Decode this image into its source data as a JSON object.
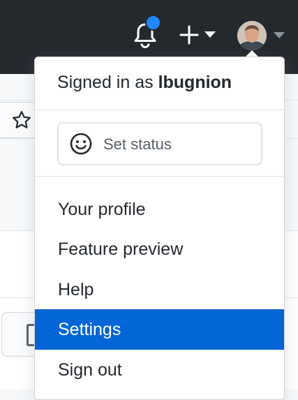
{
  "header": {
    "notification_icon": "bell-icon",
    "create_icon": "plus-icon",
    "avatar_alt": "lbugnion"
  },
  "menu": {
    "signed_in_prefix": "Signed in as",
    "username": "lbugnion",
    "status_label": "Set status",
    "status_icon": "smiley-icon",
    "items": [
      {
        "label": "Your profile",
        "active": false
      },
      {
        "label": "Feature preview",
        "active": false
      },
      {
        "label": "Help",
        "active": false
      },
      {
        "label": "Settings",
        "active": true
      },
      {
        "label": "Sign out",
        "active": false
      }
    ]
  },
  "colors": {
    "header_bg": "#24292e",
    "accent": "#0366d6",
    "notification_dot": "#2188ff"
  }
}
